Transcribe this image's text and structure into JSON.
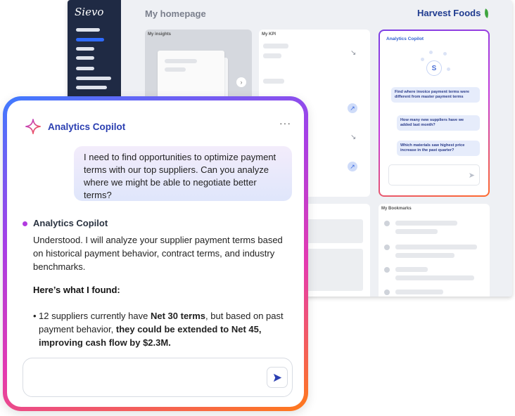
{
  "dashboard": {
    "logo": "Sievo",
    "title": "My homepage",
    "brand": "Harvest Foods",
    "panels": {
      "insights_title": "My insights",
      "kpi_title": "My KPI",
      "bookmarks_title": "My Bookmarks"
    },
    "mini_copilot": {
      "title": "Analytics Copilot",
      "logo_letter": "S",
      "questions": [
        "Find where invoice payment terms were different from master payment terms",
        "How many new suppliers have we added last month?",
        "Which materials saw highest price increase in the past quarter?"
      ]
    }
  },
  "copilot": {
    "title": "Analytics Copilot",
    "more_label": "···",
    "user_message": "I need to find opportunities to optimize payment terms with our top suppliers. Can you analyze where we might be able to negotiate better terms?",
    "assistant_name": "Analytics Copilot",
    "assistant_intro": "Understood. I will analyze your supplier payment terms based on historical payment behavior, contract terms, and industry benchmarks.",
    "findings_heading": "Here’s what I found:",
    "bullet": {
      "part1": "12 suppliers currently have ",
      "part2": "Net 30 terms",
      "part3": ", but based on past payment behavior, ",
      "part4": "they could be extended to Net 45, improving cash flow by $2.3M."
    },
    "input_value": ""
  },
  "colors": {
    "brand_blue": "#2a3eb1",
    "gradient_start": "#3f7bff",
    "gradient_mid": "#a63fe6",
    "gradient_end": "#ff7a1a",
    "sidebar": "#1f2a44",
    "leaf_green": "#3ea53e"
  },
  "icons": [
    "sparkle-icon",
    "more-icon",
    "send-icon",
    "arrow-down-right-icon",
    "arrow-up-right-icon",
    "chevron-right-icon",
    "leaf-icon"
  ]
}
